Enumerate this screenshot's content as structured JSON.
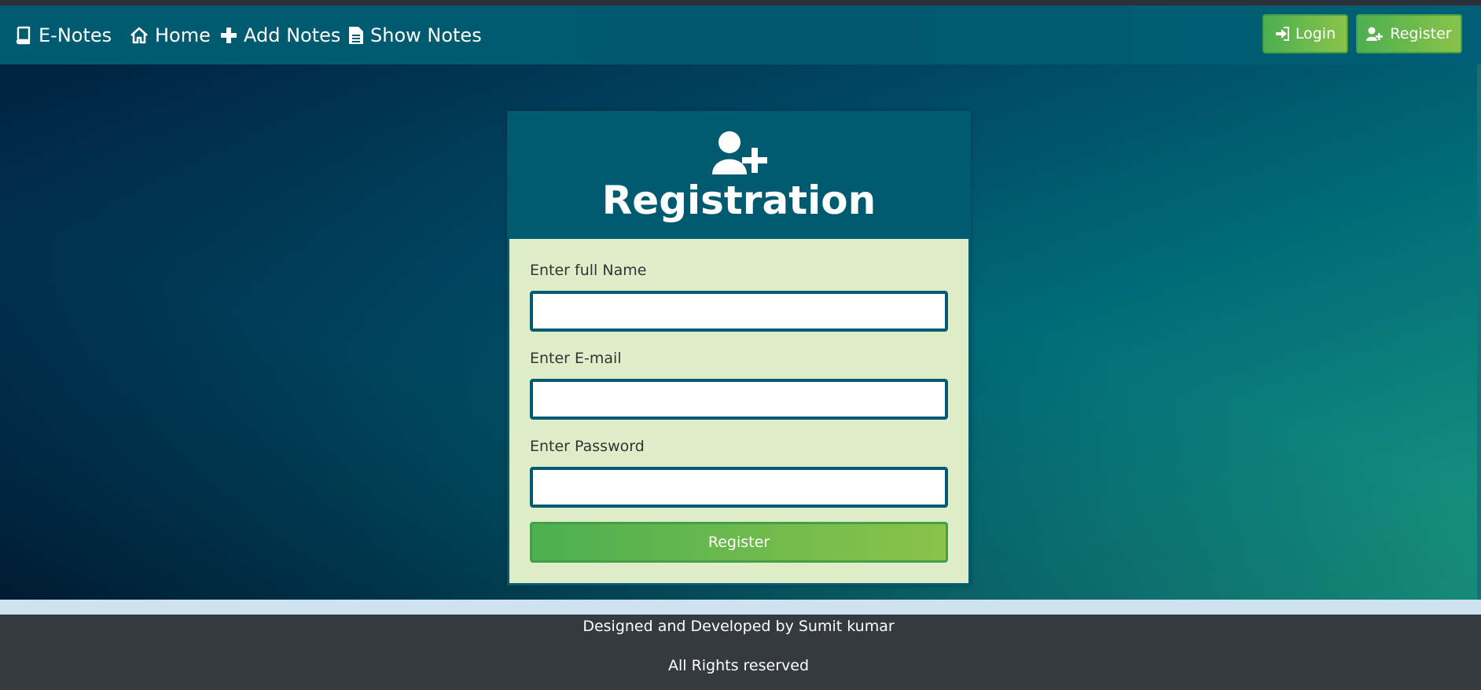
{
  "navbar": {
    "brand": "E-Notes",
    "brand_icon": "book-icon",
    "links": [
      {
        "label": "Home",
        "icon": "home-icon"
      },
      {
        "label": "Add Notes",
        "icon": "plus-icon"
      },
      {
        "label": "Show Notes",
        "icon": "file-text-icon"
      }
    ],
    "login_label": "Login",
    "login_icon": "sign-in-icon",
    "register_label": "Register",
    "register_icon": "user-plus-icon"
  },
  "form": {
    "title": "Registration",
    "title_icon": "user-plus-icon",
    "name_label": "Enter full Name",
    "name_value": "",
    "email_label": "Enter E-mail",
    "email_value": "",
    "password_label": "Enter Password",
    "password_value": "",
    "submit_label": "Register"
  },
  "footer": {
    "credit": "Designed and Developed by Sumit kumar",
    "rights": "All Rights reserved"
  },
  "colors": {
    "navbar": "#005a70",
    "card_body": "#dfeec9",
    "button_start": "#4caf50",
    "button_end": "#8bc34a",
    "footer": "#343a40"
  }
}
